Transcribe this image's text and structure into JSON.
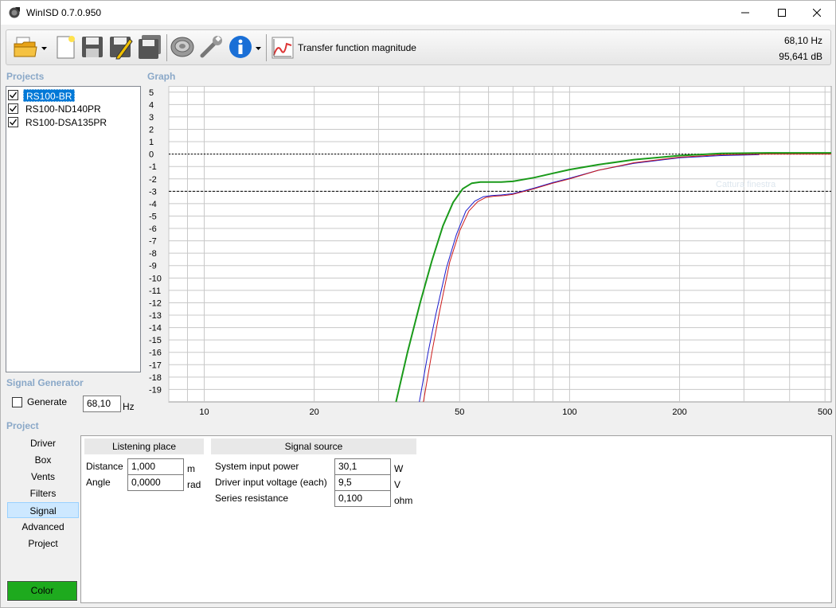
{
  "window": {
    "title": "WinISD 0.7.0.950"
  },
  "toolbar": {
    "view_label": "Transfer function magnitude",
    "freq_readout": "68,10 Hz",
    "db_readout": "95,641 dB"
  },
  "projects": {
    "title": "Projects",
    "items": [
      {
        "label": "RS100-BR",
        "checked": true,
        "selected": true
      },
      {
        "label": "RS100-ND140PR",
        "checked": true,
        "selected": false
      },
      {
        "label": "RS100-DSA135PR",
        "checked": true,
        "selected": false
      }
    ]
  },
  "graph": {
    "title": "Graph",
    "tooltip": "Cattura finestra"
  },
  "chart_data": {
    "type": "line",
    "title": "",
    "xlabel": "",
    "ylabel": "",
    "x_scale": "log",
    "xlim": [
      8,
      520
    ],
    "ylim": [
      -20,
      5.5
    ],
    "x_ticks": [
      10,
      20,
      50,
      100,
      200,
      500
    ],
    "y_ticks": [
      5,
      4,
      3,
      2,
      1,
      0,
      -1,
      -2,
      -3,
      -4,
      -5,
      -6,
      -7,
      -8,
      -9,
      -10,
      -11,
      -12,
      -13,
      -14,
      -15,
      -16,
      -17,
      -18,
      -19
    ],
    "reference_lines": [
      0,
      -3
    ],
    "grid": true,
    "series": [
      {
        "color": "#1a9a1a",
        "x": [
          33.5,
          36,
          39,
          42,
          45,
          48,
          51,
          54,
          57,
          60,
          65,
          70,
          80,
          90,
          100,
          120,
          150,
          200,
          260,
          350,
          520
        ],
        "y": [
          -20,
          -16,
          -12,
          -8.6,
          -5.8,
          -3.9,
          -2.8,
          -2.35,
          -2.25,
          -2.25,
          -2.25,
          -2.2,
          -1.9,
          -1.55,
          -1.25,
          -0.85,
          -0.45,
          -0.12,
          0.05,
          0.1,
          0.1
        ]
      },
      {
        "color": "#1a1acc",
        "x": [
          38.8,
          41,
          43,
          46,
          49,
          52,
          55,
          58,
          61,
          65,
          70,
          80,
          90,
          100,
          120,
          150,
          200,
          260,
          330
        ],
        "y": [
          -20,
          -16,
          -13,
          -9.2,
          -6.5,
          -4.6,
          -3.8,
          -3.45,
          -3.35,
          -3.3,
          -3.2,
          -2.75,
          -2.3,
          -1.95,
          -1.3,
          -0.75,
          -0.3,
          -0.12,
          -0.05
        ]
      },
      {
        "color": "#cc1a1a",
        "x": [
          39.8,
          42,
          44,
          47,
          50,
          53,
          56,
          59,
          62,
          66,
          70,
          80,
          90,
          100,
          120,
          150,
          200,
          260,
          350,
          520
        ],
        "y": [
          -20,
          -16,
          -12.8,
          -8.7,
          -6.2,
          -4.6,
          -3.85,
          -3.5,
          -3.4,
          -3.35,
          -3.25,
          -2.8,
          -2.35,
          -2.0,
          -1.3,
          -0.7,
          -0.25,
          -0.05,
          0.0,
          0.0
        ]
      }
    ]
  },
  "signal_generator": {
    "title": "Signal Generator",
    "generate_label": "Generate",
    "generate_checked": false,
    "frequency": "68,10",
    "unit": "Hz"
  },
  "project_nav": {
    "title": "Project",
    "items": [
      "Driver",
      "Box",
      "Vents",
      "Filters",
      "Signal",
      "Advanced",
      "Project"
    ],
    "selected_index": 4,
    "color_button": "Color",
    "color_value": "#1eaa1e"
  },
  "listening_place": {
    "title": "Listening place",
    "distance_label": "Distance",
    "distance_value": "1,000",
    "distance_unit": "m",
    "angle_label": "Angle",
    "angle_value": "0,0000",
    "angle_unit": "rad"
  },
  "signal_source": {
    "title": "Signal source",
    "power_label": "System input power",
    "power_value": "30,1",
    "power_unit": "W",
    "voltage_label": "Driver input voltage (each)",
    "voltage_value": "9,5",
    "voltage_unit": "V",
    "resistance_label": "Series resistance",
    "resistance_value": "0,100",
    "resistance_unit": "ohm"
  }
}
